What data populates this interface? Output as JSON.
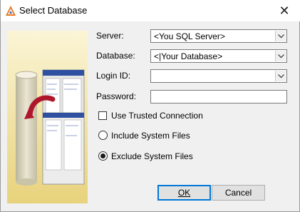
{
  "window": {
    "title": "Select Database",
    "close_glyph": "✕",
    "icon": "app-triangle-icon"
  },
  "form": {
    "server": {
      "label": "Server:",
      "value": "<You SQL Server>"
    },
    "database": {
      "label": "Database:",
      "value": "<|Your Database>"
    },
    "login_id": {
      "label": "Login ID:",
      "value": ""
    },
    "password": {
      "label": "Password:",
      "value": ""
    }
  },
  "options": {
    "use_trusted": {
      "label": "Use Trusted Connection",
      "checked": false
    },
    "include_system": {
      "label": "Include System Files",
      "selected": false
    },
    "exclude_system": {
      "label": "Exclude System Files",
      "selected": true
    }
  },
  "buttons": {
    "ok": "OK",
    "cancel": "Cancel"
  },
  "colors": {
    "accent": "#0078d7",
    "dialog_bg": "#f0f0f0",
    "art_bg": "#f2e6a6"
  }
}
